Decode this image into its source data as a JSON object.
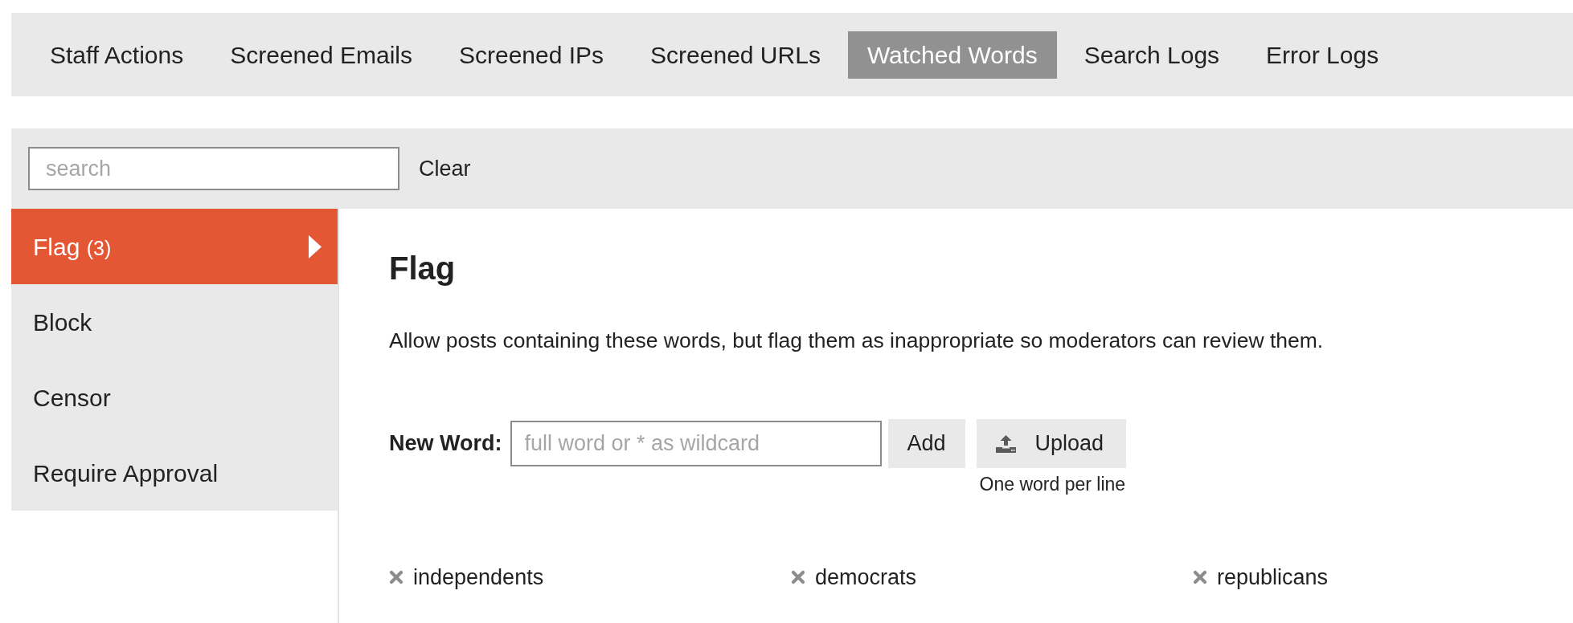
{
  "nav_tabs": [
    {
      "label": "Staff Actions",
      "selected": false
    },
    {
      "label": "Screened Emails",
      "selected": false
    },
    {
      "label": "Screened IPs",
      "selected": false
    },
    {
      "label": "Screened URLs",
      "selected": false
    },
    {
      "label": "Watched Words",
      "selected": true
    },
    {
      "label": "Search Logs",
      "selected": false
    },
    {
      "label": "Error Logs",
      "selected": false
    }
  ],
  "filter": {
    "search": {
      "placeholder": "search"
    },
    "clear_button": "Clear"
  },
  "sidebar": {
    "items": [
      {
        "label": "Flag",
        "count": "(3)",
        "selected": true
      },
      {
        "label": "Block",
        "selected": false
      },
      {
        "label": "Censor",
        "selected": false
      },
      {
        "label": "Require Approval",
        "selected": false
      }
    ]
  },
  "panel": {
    "title": "Flag",
    "description": "Allow posts containing these words, but flag them as inappropriate so moderators can review them.",
    "new_word": {
      "label": "New Word:",
      "placeholder": "full word or * as wildcard",
      "add_button": "Add",
      "upload_button": "Upload",
      "upload_hint": "One word per line"
    },
    "words": [
      "independents",
      "democrats",
      "republicans"
    ]
  }
}
